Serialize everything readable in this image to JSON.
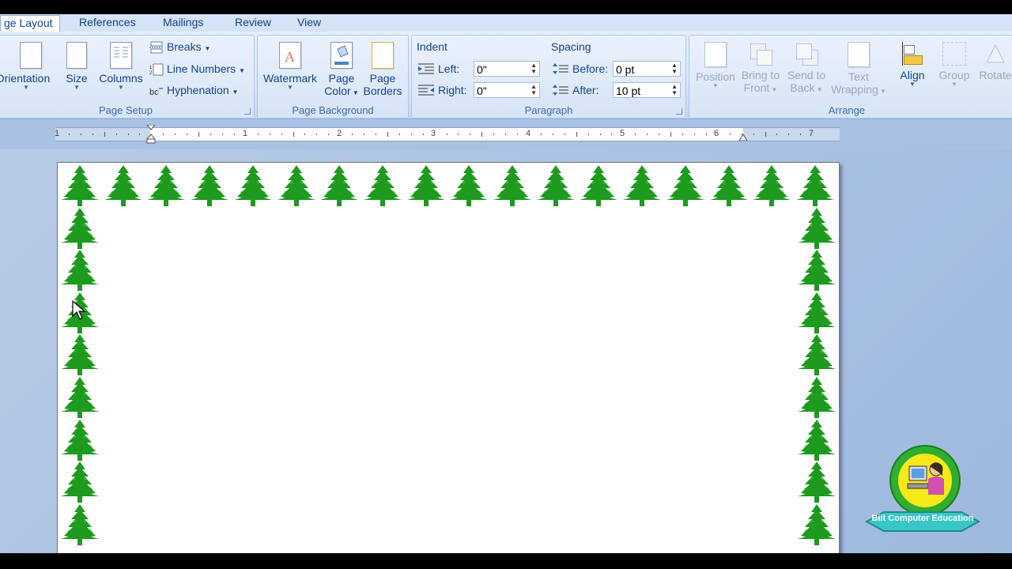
{
  "tabs": [
    {
      "label": "ge Layout",
      "active": true
    },
    {
      "label": "References"
    },
    {
      "label": "Mailings"
    },
    {
      "label": "Review"
    },
    {
      "label": "View"
    }
  ],
  "page_setup": {
    "label": "Page Setup",
    "orientation": "Orientation",
    "size": "Size",
    "columns": "Columns",
    "breaks": "Breaks",
    "line_numbers": "Line Numbers",
    "hyphenation": "Hyphenation"
  },
  "page_background": {
    "label": "Page Background",
    "watermark": "Watermark",
    "page_color_1": "Page",
    "page_color_2": "Color",
    "page_borders_1": "Page",
    "page_borders_2": "Borders"
  },
  "paragraph": {
    "label": "Paragraph",
    "indent_title": "Indent",
    "left_label": "Left:",
    "left_value": "0\"",
    "right_label": "Right:",
    "right_value": "0\"",
    "spacing_title": "Spacing",
    "before_label": "Before:",
    "before_value": "0 pt",
    "after_label": "After:",
    "after_value": "10 pt"
  },
  "arrange": {
    "label": "Arrange",
    "position": "Position",
    "bring_front_1": "Bring to",
    "bring_front_2": "Front",
    "send_back_1": "Send to",
    "send_back_2": "Back",
    "text_wrap_1": "Text",
    "text_wrap_2": "Wrapping",
    "align": "Align",
    "group": "Group",
    "rotate": "Rotate"
  },
  "ruler": {
    "numbers": [
      "1",
      "1",
      "2",
      "3",
      "4",
      "5",
      "6",
      "7"
    ]
  },
  "logo_text": "Biit Computer Education",
  "colors": {
    "tree": "#1e9a1e",
    "ribbon": "#dae6f6",
    "canvas": "#a7c0e2"
  },
  "icons": [
    "orientation-icon",
    "size-icon",
    "columns-icon",
    "breaks-icon",
    "line-numbers-icon",
    "hyphenation-icon",
    "watermark-icon",
    "page-color-icon",
    "page-borders-icon",
    "indent-left-icon",
    "indent-right-icon",
    "spacing-before-icon",
    "spacing-after-icon",
    "tree-icon",
    "mouse-cursor-icon"
  ]
}
